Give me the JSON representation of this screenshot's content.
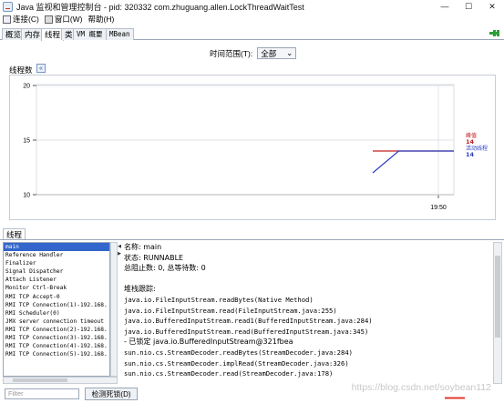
{
  "window": {
    "title": "Java 监视和管理控制台 - pid: 320332 com.zhuguang.allen.LockThreadWaitTest",
    "minimize": "—",
    "maximize": "☐",
    "close": "✕"
  },
  "menu": [
    "连接(C)",
    "窗口(W)",
    "帮助(H)"
  ],
  "tabs": [
    "概览",
    "内存",
    "线程",
    "类",
    "VM 概要",
    "MBean"
  ],
  "active_tab": "线程",
  "time_range": {
    "label": "时间范围(T):",
    "value": "全部"
  },
  "chart_panel": {
    "label": "线程数",
    "collapse": "«"
  },
  "chart_data": {
    "type": "line",
    "y_ticks": [
      "20",
      "15",
      "10"
    ],
    "ylim": [
      10,
      20
    ],
    "x_tick": "19:50",
    "series": [
      {
        "name": "峰值",
        "color": "#c02020",
        "current": "14",
        "x": [
          0,
          1
        ],
        "y": [
          14,
          14
        ]
      },
      {
        "name": "活动线程",
        "color": "#2c3fc2",
        "current": "14",
        "x": [
          0,
          0.32,
          1
        ],
        "y": [
          12,
          14,
          14
        ]
      }
    ]
  },
  "threads_tab": "线程",
  "thread_list": [
    "main",
    "Reference Handler",
    "Finalizer",
    "Signal Dispatcher",
    "Attach Listener",
    "Monitor Ctrl-Break",
    "RMI TCP Accept-0",
    "RMI TCP Connection(1)-192.168.",
    "RMI Scheduler(0)",
    "JMX server connection timeout",
    "RMI TCP Connection(2)-192.168.",
    "RMI TCP Connection(3)-192.168.",
    "RMI TCP Connection(4)-192.168.",
    "RMI TCP Connection(5)-192.168."
  ],
  "selected_thread": "main",
  "details": [
    "名称: main",
    "状态: RUNNABLE",
    "总阻止数: 0, 总等待数: 0",
    "",
    "堆栈跟踪:",
    "java.io.FileInputStream.readBytes(Native Method)",
    "java.io.FileInputStream.read(FileInputStream.java:255)",
    "java.io.BufferedInputStream.read1(BufferedInputStream.java:284)",
    "java.io.BufferedInputStream.read(BufferedInputStream.java:345)",
    "   - 已锁定 java.io.BufferedInputStream@321fbea",
    "sun.nio.cs.StreamDecoder.readBytes(StreamDecoder.java:284)",
    "sun.nio.cs.StreamDecoder.implRead(StreamDecoder.java:326)",
    "sun.nio.cs.StreamDecoder.read(StreamDecoder.java:178)"
  ],
  "filter_placeholder": "Filter",
  "detect_deadlock": "检测死锁(D)",
  "watermark": "https://blog.csdn.net/soybean112"
}
